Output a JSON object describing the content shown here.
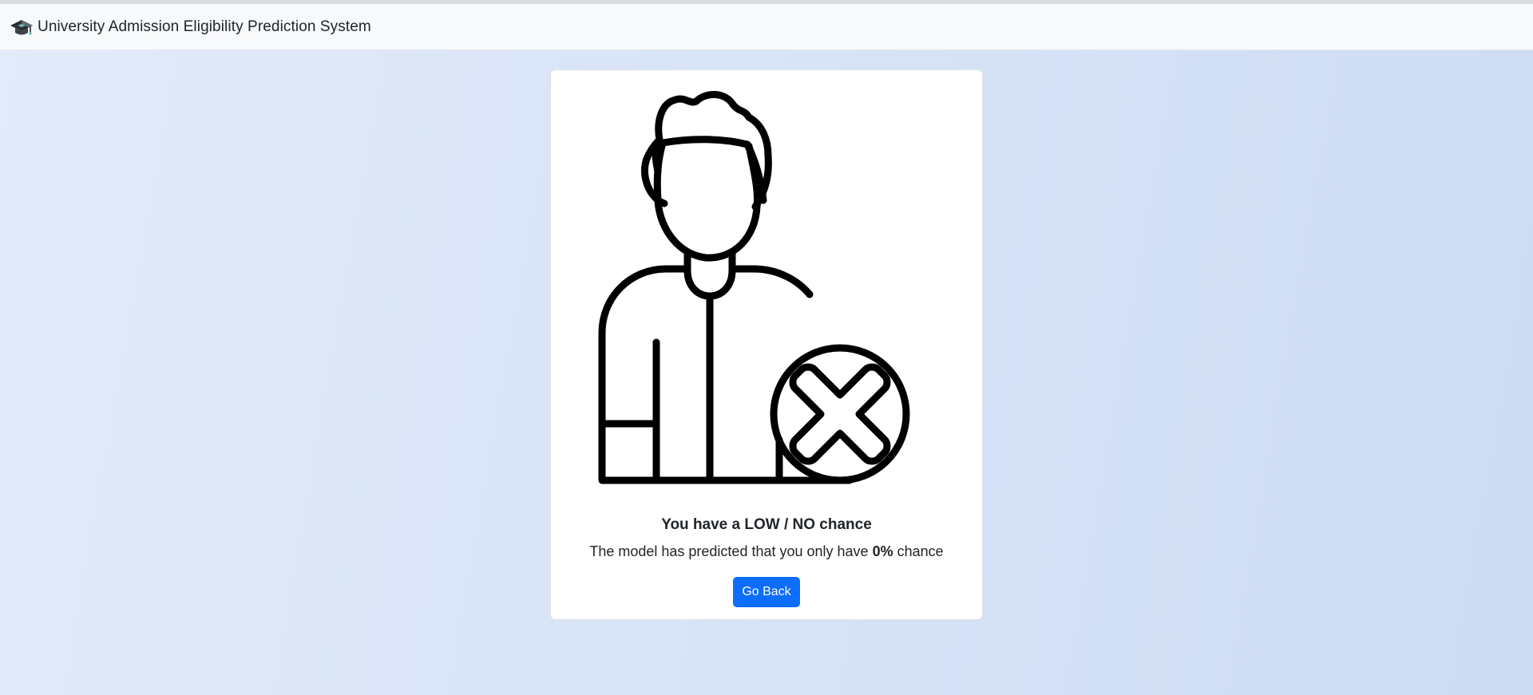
{
  "navbar": {
    "brand_icon": "graduation-cap-icon",
    "brand_text": "University Admission Eligibility Prediction System"
  },
  "result": {
    "illustration_icon": "person-rejected-icon",
    "title": "You have a LOW / NO chance",
    "desc_prefix": "The model has predicted that you only have",
    "chance_value": "0%",
    "desc_suffix": "chance",
    "back_button": "Go Back"
  },
  "colors": {
    "primary": "#0d6efd",
    "navbar_bg": "#f8f9fa",
    "text": "#212529"
  }
}
